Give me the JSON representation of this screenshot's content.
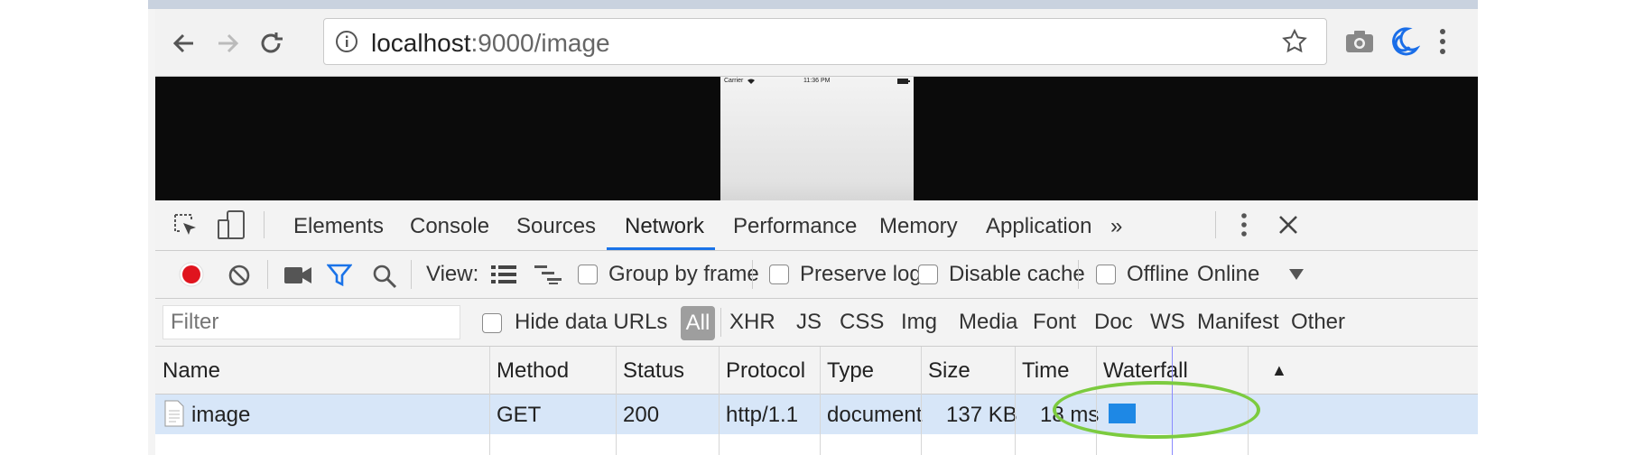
{
  "browser": {
    "url_host": "localhost",
    "url_rest": ":9000/image",
    "nav": [
      "back-icon",
      "forward-icon",
      "reload-icon"
    ],
    "icons": [
      "info-icon",
      "star-icon",
      "camera-icon",
      "moon-extension-icon",
      "menu-kebab-icon"
    ]
  },
  "viewport": {
    "phone_status": {
      "carrier": "Carrier",
      "time": "11:36 PM"
    }
  },
  "devtools": {
    "tabs": [
      "Elements",
      "Console",
      "Sources",
      "Network",
      "Performance",
      "Memory",
      "Application",
      "»"
    ],
    "active_tab": "Network",
    "controls": {
      "view_label": "View:",
      "group_by_frame": "Group by frame",
      "preserve_log": "Preserve log",
      "disable_cache": "Disable cache",
      "offline": "Offline",
      "throttling": "Online"
    },
    "filter": {
      "placeholder": "Filter",
      "hide_data_urls": "Hide data URLs",
      "types": [
        "All",
        "XHR",
        "JS",
        "CSS",
        "Img",
        "Media",
        "Font",
        "Doc",
        "WS",
        "Manifest",
        "Other"
      ],
      "active_type": "All"
    },
    "table": {
      "columns": [
        "Name",
        "Method",
        "Status",
        "Protocol",
        "Type",
        "Size",
        "Time",
        "Waterfall"
      ],
      "sort_indicator": "▲",
      "rows": [
        {
          "name": "image",
          "method": "GET",
          "status": "200",
          "protocol": "http/1.1",
          "type": "document",
          "size": "137 KB",
          "time": "18 ms"
        }
      ]
    }
  },
  "colors": {
    "accent": "#1a73e8",
    "record": "#e0141e",
    "highlight": "#7ccb3f",
    "selected_row": "#d7e6f8"
  }
}
